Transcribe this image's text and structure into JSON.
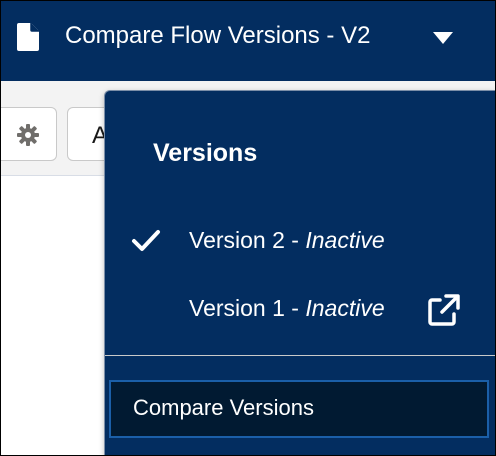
{
  "header": {
    "title": "Compare Flow Versions - V2",
    "icon": "document-icon"
  },
  "toolbar": {
    "partial_button_label": "A"
  },
  "versions_menu": {
    "heading": "Versions",
    "items": [
      {
        "prefix": "Version 2 - ",
        "status": "Inactive",
        "selected": true
      },
      {
        "prefix": "Version 1 - ",
        "status": "Inactive",
        "selected": false,
        "icon": "external-link-icon"
      }
    ],
    "compare_label": "Compare Versions"
  }
}
